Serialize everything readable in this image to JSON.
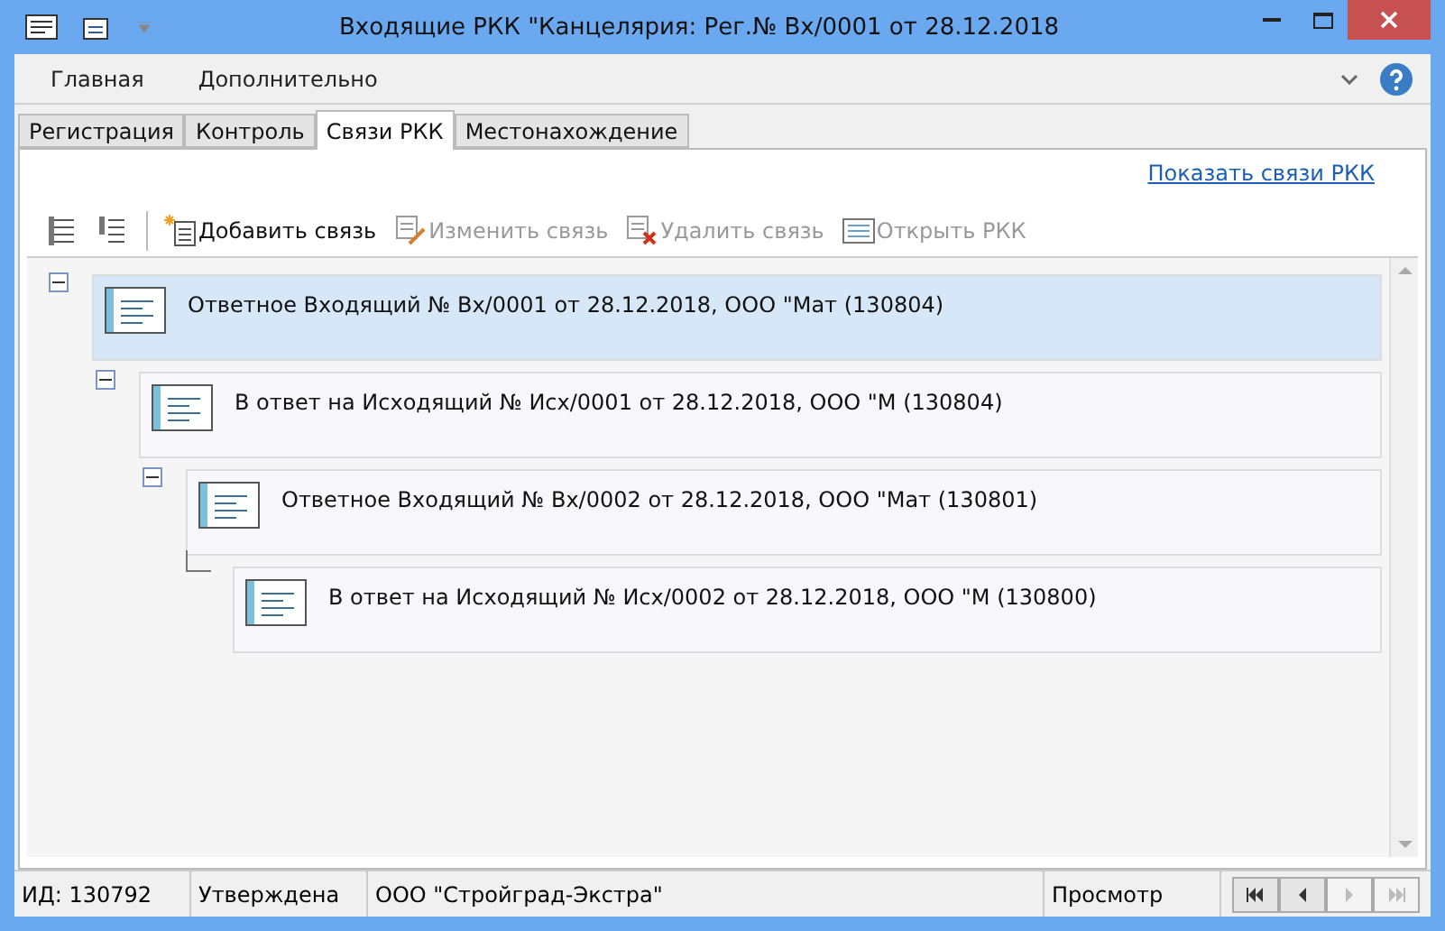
{
  "window": {
    "title": "Входящие РКК \"Канцелярия: Рег.№ Вх/0001 от 28.12.2018"
  },
  "ribbon_tabs": [
    "Главная",
    "Дополнительно"
  ],
  "tabs": [
    {
      "label": "Регистрация",
      "selected": false
    },
    {
      "label": "Контроль",
      "selected": false
    },
    {
      "label": "Связи РКК",
      "selected": true
    },
    {
      "label": "Местонахождение",
      "selected": false
    }
  ],
  "show_links": "Показать связи РКК",
  "toolbar": [
    {
      "kind": "expand"
    },
    {
      "kind": "collapse"
    },
    {
      "kind": "add",
      "label": "Добавить связь",
      "disabled": false
    },
    {
      "kind": "edit",
      "label": "Изменить связь",
      "disabled": true
    },
    {
      "kind": "delete",
      "label": "Удалить связь",
      "disabled": true
    },
    {
      "kind": "open",
      "label": "Открыть РКК",
      "disabled": true
    }
  ],
  "tree": [
    {
      "text": "Ответное Входящий № Вх/0001 от 28.12.2018, ООО \"Мат (130804)",
      "selected": true,
      "expanded": true,
      "children": [
        {
          "text": "В ответ на Исходящий № Исх/0001 от 28.12.2018, ООО \"М (130804)",
          "selected": false,
          "expanded": true,
          "children": [
            {
              "text": "Ответное Входящий № Вх/0002 от 28.12.2018, ООО \"Мат (130801)",
              "selected": false,
              "expanded": true,
              "children": [
                {
                  "text": "В ответ на Исходящий № Исх/0002 от 28.12.2018, ООО \"М (130800)",
                  "selected": false
                }
              ]
            }
          ]
        }
      ]
    }
  ],
  "status_bar": {
    "id": "ИД: 130792",
    "state": "Утверждена",
    "org": "ООО \"Стройград-Экстра\"",
    "mode": "Просмотр",
    "nav": [
      {
        "kind": "first",
        "disabled": false
      },
      {
        "kind": "prev",
        "disabled": false
      },
      {
        "kind": "next",
        "disabled": true
      },
      {
        "kind": "last",
        "disabled": true
      }
    ]
  }
}
